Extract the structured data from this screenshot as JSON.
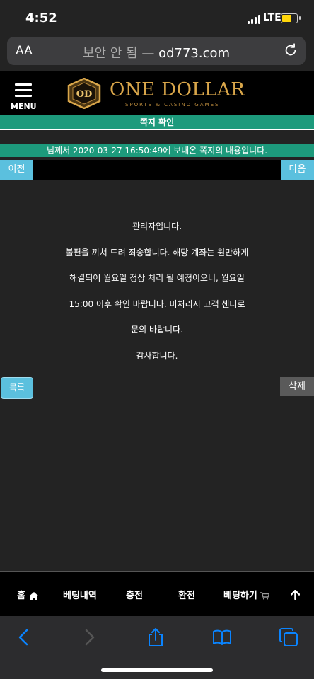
{
  "status_bar": {
    "time": "4:52",
    "network": "LTE"
  },
  "browser": {
    "text_size_label": "AA",
    "security_label": "보안 안 됨 —",
    "host": "od773.com"
  },
  "site": {
    "menu_label": "MENU",
    "logo_text": "ONE DOLLAR",
    "logo_subtitle": "SPORTS & CASINO GAMES",
    "logo_emblem": "OD"
  },
  "page": {
    "title": "쪽지 확인",
    "info": "님께서 2020-03-27 16:50:49에 보내온 쪽지의 내용입니다.",
    "prev_label": "이전",
    "next_label": "다음",
    "message_lines": [
      "관리자입니다.",
      "불편을 끼쳐 드려 죄송합니다. 해당 계좌는 원만하게",
      "해결되어 월요일 정상 처리 될 예정이오니, 월요일",
      "15:00 이후 확인 바랍니다. 미처리시 고객 센터로",
      "문의 바랍니다.",
      "감사합니다."
    ],
    "list_label": "목록",
    "delete_label": "삭제"
  },
  "bottom_nav": {
    "home": "홈",
    "betting_history": "베팅내역",
    "deposit": "충전",
    "withdraw": "환전",
    "place_bet": "베팅하기"
  },
  "colors": {
    "accent_green": "#1d9a7c",
    "button_blue": "#5bc0de",
    "logo_gold": "#d9a64a",
    "battery_yellow": "#ffd60a",
    "toolbar_blue": "#0a84ff"
  }
}
